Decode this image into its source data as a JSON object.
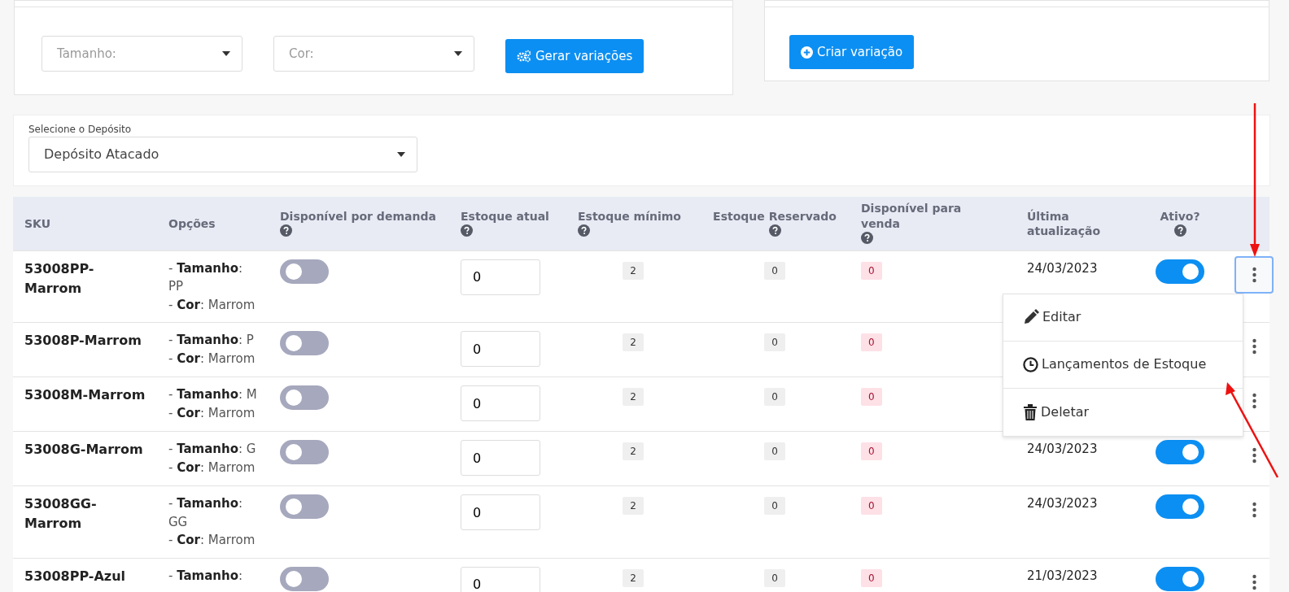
{
  "variation_generator": {
    "selects": [
      {
        "placeholder": "Tamanho:"
      },
      {
        "placeholder": "Cor:"
      }
    ],
    "button": "Gerar variações"
  },
  "create_variation": {
    "button": "Criar variação"
  },
  "warehouse": {
    "label": "Selecione o Depósito",
    "value": "Depósito Atacado"
  },
  "table": {
    "columns": [
      {
        "kind": "sku",
        "label": "SKU",
        "help": false
      },
      {
        "kind": "options",
        "label": "Opções",
        "help": false
      },
      {
        "kind": "on_demand",
        "label": "Disponível por demanda",
        "help": true
      },
      {
        "kind": "stock",
        "label": "Estoque atual",
        "help": true
      },
      {
        "kind": "min",
        "label": "Estoque mínimo",
        "help": true
      },
      {
        "kind": "reserved",
        "label": "Estoque Reservado",
        "help": true
      },
      {
        "kind": "available",
        "label": "Disponível para venda",
        "help": true
      },
      {
        "kind": "updated",
        "label": "Última atualização",
        "help": false
      },
      {
        "kind": "active",
        "label": "Ativo?",
        "help": true
      }
    ],
    "rows": [
      {
        "sku": "53008PP-Marrom",
        "options": [
          "- **Tamanho**: PP",
          "- **Cor**: Marrom"
        ],
        "on_demand": false,
        "stock": "0",
        "min": "2",
        "reserved": "0",
        "available": "0",
        "updated": "24/03/2023",
        "active": true,
        "menu_open": true
      },
      {
        "sku": "53008P-Marrom",
        "options": [
          "- **Tamanho**: P",
          "- **Cor**: Marrom"
        ],
        "on_demand": false,
        "stock": "0",
        "min": "2",
        "reserved": "0",
        "available": "0",
        "menu_open": false
      },
      {
        "sku": "53008M-Marrom",
        "options": [
          "- **Tamanho**: M",
          "- **Cor**: Marrom"
        ],
        "on_demand": false,
        "stock": "0",
        "min": "2",
        "reserved": "0",
        "available": "0",
        "menu_open": false
      },
      {
        "sku": "53008G-Marrom",
        "options": [
          "- **Tamanho**: G",
          "- **Cor**: Marrom"
        ],
        "on_demand": false,
        "stock": "0",
        "min": "2",
        "reserved": "0",
        "available": "0",
        "updated": "24/03/2023",
        "active": true,
        "menu_open": false
      },
      {
        "sku": "53008GG-Marrom",
        "options": [
          "- **Tamanho**: GG",
          "- **Cor**: Marrom"
        ],
        "on_demand": false,
        "stock": "0",
        "min": "2",
        "reserved": "0",
        "available": "0",
        "updated": "24/03/2023",
        "active": true,
        "menu_open": false
      },
      {
        "sku": "53008PP-Azul",
        "options": [
          "- **Tamanho**:"
        ],
        "on_demand": false,
        "stock": "0",
        "min": "2",
        "reserved": "0",
        "available": "0",
        "updated": "21/03/2023",
        "active": true,
        "menu_open": false
      }
    ]
  },
  "row_menu": {
    "items": [
      {
        "kind": "edit",
        "label": "Editar"
      },
      {
        "kind": "history",
        "label": "Lançamentos de Estoque"
      },
      {
        "kind": "delete",
        "label": "Deletar"
      }
    ]
  }
}
